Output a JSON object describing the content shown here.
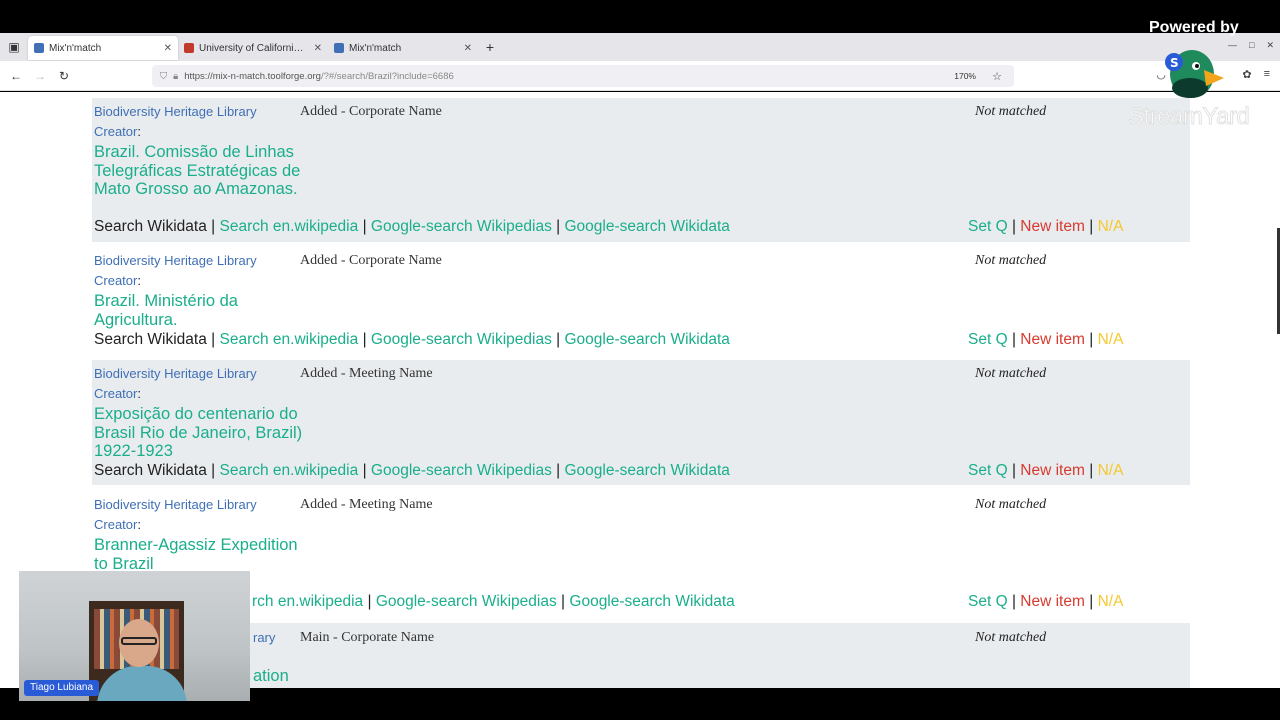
{
  "browser": {
    "tabs": [
      {
        "title": "Mix'n'match",
        "active": true,
        "favicon_color": "#3f6fb5"
      },
      {
        "title": "University of California - Wiki",
        "active": false,
        "favicon_color": "#c0392b"
      },
      {
        "title": "Mix'n'match",
        "active": false,
        "favicon_color": "#3f6fb5"
      }
    ],
    "new_tab": "+",
    "url_main": "https://mix-n-match.toolforge.org",
    "url_rest": "/?#/search/Brazil?include=6686",
    "zoom": "170%"
  },
  "entries": [
    {
      "catalog": "Biodiversity Heritage Library",
      "type": "Added - Corporate Name",
      "status": "Not matched",
      "creator_label": "Creator",
      "name": "Brazil. Comissão de Linhas Telegráficas Estratégicas de Mato Grosso ao Amazonas.",
      "shaded": true
    },
    {
      "catalog": "Biodiversity Heritage Library",
      "type": "Added - Corporate Name",
      "status": "Not matched",
      "creator_label": "Creator",
      "name": "Brazil. Ministério da Agricultura.",
      "shaded": false
    },
    {
      "catalog": "Biodiversity Heritage Library",
      "type": "Added - Meeting Name",
      "status": "Not matched",
      "creator_label": "Creator",
      "name": "Exposição do centenario do Brasil Rio de Janeiro, Brazil) 1922-1923",
      "shaded": true
    },
    {
      "catalog": "Biodiversity Heritage Library",
      "type": "Added - Meeting Name",
      "status": "Not matched",
      "creator_label": "Creator",
      "name": "Branner-Agassiz Expedition to Brazil",
      "shaded": false
    },
    {
      "catalog": "rary",
      "type": "Main - Corporate Name",
      "status": "Not matched",
      "name": "ation",
      "shaded": true
    }
  ],
  "links": {
    "search_wikidata": "Search Wikidata",
    "search_enwiki": "Search en.wikipedia",
    "search_enwiki_partial": "rch en.wikipedia",
    "google_wikipedias": "Google-search Wikipedias",
    "google_wikidata": "Google-search Wikidata",
    "sep": "|"
  },
  "actions": {
    "set_q": "Set Q",
    "new_item": "New item",
    "na": "N/A"
  },
  "overlay": {
    "powered_by": "Powered by",
    "brand": "StreamYard",
    "presenter": "Tiago Lubiana"
  }
}
